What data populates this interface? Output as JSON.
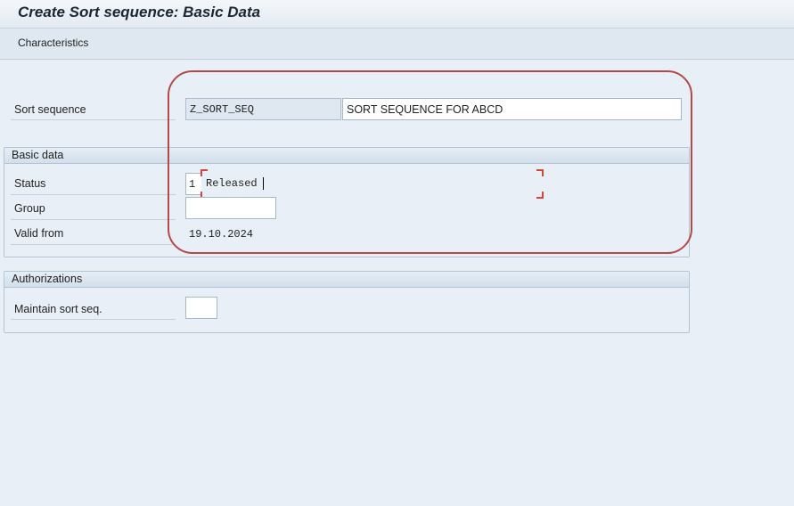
{
  "window": {
    "title": "Create Sort sequence: Basic Data"
  },
  "toolbar": {
    "characteristics_label": "Characteristics"
  },
  "sort_sequence": {
    "label": "Sort sequence",
    "id": "Z_SORT_SEQ",
    "description": "SORT SEQUENCE FOR ABCD"
  },
  "basic_data": {
    "header": "Basic data",
    "status_label": "Status",
    "status_code": "1",
    "status_text": "Released",
    "group_label": "Group",
    "group_value": "",
    "valid_from_label": "Valid from",
    "valid_from_value": "19.10.2024"
  },
  "authorizations": {
    "header": "Authorizations",
    "maintain_label": "Maintain sort seq.",
    "maintain_value": ""
  },
  "colors": {
    "highlight": "#b24a4a",
    "focus_bracket": "#d4453c"
  }
}
